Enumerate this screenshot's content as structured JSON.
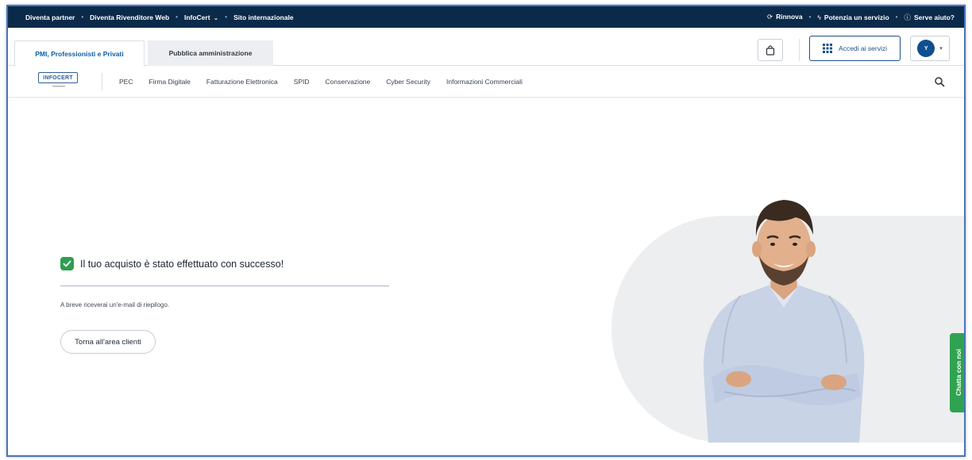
{
  "topbar": {
    "left_links": [
      "Diventa partner",
      "Diventa Rivenditore Web",
      "InfoCert",
      "Sito internazionale"
    ],
    "right_links": [
      "Rinnova",
      "Potenzia un servizio",
      "Serve aiuto?"
    ]
  },
  "tabs": {
    "active": "PMI, Professionisti e Privati",
    "inactive": "Pubblica amministrazione"
  },
  "header": {
    "accedi_label": "Accedi ai servizi",
    "avatar_initial": "Y"
  },
  "logo": {
    "text": "INFOCERT"
  },
  "nav": {
    "items": [
      "PEC",
      "Firma Digitale",
      "Fatturazione Elettronica",
      "SPID",
      "Conservazione",
      "Cyber Security",
      "Informazioni Commerciali"
    ]
  },
  "main": {
    "success_title": "Il tuo acquisto è stato effettuato con successo!",
    "sub_text": "A breve riceverai un'e-mail di riepilogo.",
    "back_button": "Torna all'area clienti"
  },
  "chat": {
    "label": "Chatta con noi"
  },
  "colors": {
    "topbar_bg": "#0b2a4a",
    "accent_blue": "#1f4f86",
    "success_green": "#2e9e50",
    "chat_green": "#2fa34f"
  }
}
